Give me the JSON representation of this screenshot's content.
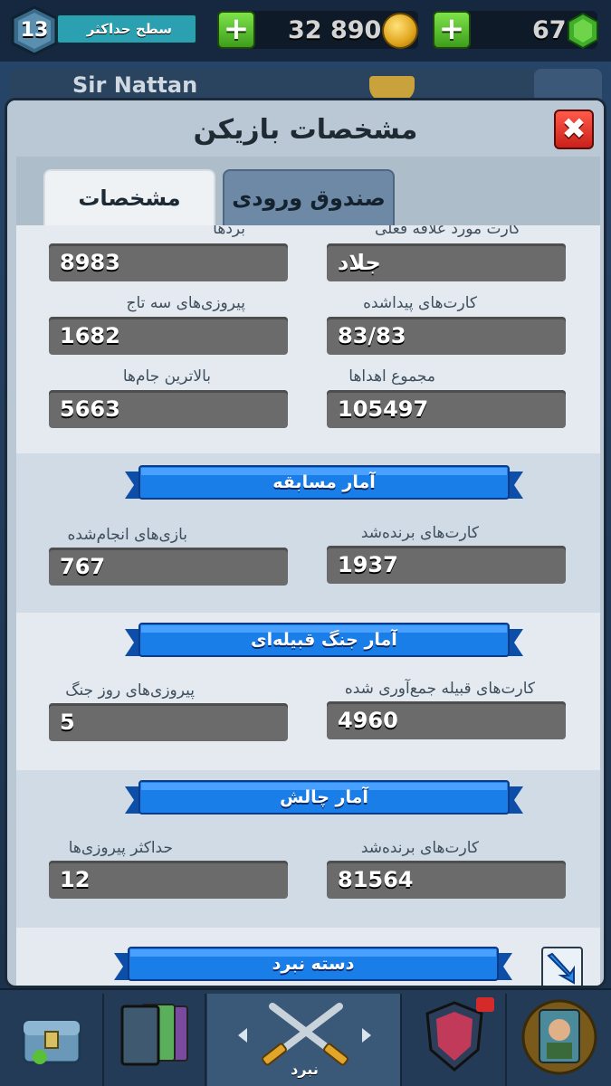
{
  "top_bar": {
    "level": "13",
    "xp_label": "سطح حداکثر",
    "gold_plus": "+",
    "gold_value": "32 890",
    "gems_plus": "+",
    "gems_value": "67"
  },
  "background": {
    "player_name": "Sir Nattan"
  },
  "modal": {
    "title": "مشخصات بازیکن",
    "close_label": "✖",
    "tabs": [
      {
        "label": "مشخصات",
        "active": true
      },
      {
        "label": "صندوق ورودی",
        "active": false
      }
    ]
  },
  "stats": {
    "wins_label": "بردها",
    "wins_value": "8983",
    "favorite_card_label": "کارت مورد علاقه فعلی",
    "favorite_card_value": "جلاد",
    "three_crown_label": "پیروزی‌های سه تاج",
    "three_crown_value": "1682",
    "cards_found_label": "کارت‌های پیداشده",
    "cards_found_value": "83/83",
    "best_trophies_label": "بالاترین جام‌ها",
    "best_trophies_value": "5663",
    "total_donations_label": "مجموع اهداها",
    "total_donations_value": "105497"
  },
  "tournament": {
    "title": "آمار مسابقه",
    "games_label": "بازی‌های انجام‌شده",
    "games_value": "767",
    "cards_won_label": "کارت‌های برنده‌شد",
    "cards_won_value": "1937"
  },
  "clan_war": {
    "title": "آمار جنگ قبیله‌ای",
    "war_wins_label": "پیروزی‌های روز جنگ",
    "war_wins_value": "5",
    "clan_cards_label": "کارت‌های قبیله جمع‌آوری شده",
    "clan_cards_value": "4960"
  },
  "challenge": {
    "title": "آمار چالش",
    "max_wins_label": "حداکثر پیروزی‌ها",
    "max_wins_value": "12",
    "cards_won_label": "کارت‌های برنده‌شد",
    "cards_won_value": "81564"
  },
  "battle_deck": {
    "title": "دسته نبرد"
  },
  "bottom_nav": {
    "center_label": "نبرد",
    "left_arrow": "◀",
    "right_arrow": "▶"
  },
  "colors": {
    "ribbon_blue": "#1a7ee8",
    "value_box": "#6b6b6b",
    "modal_bg": "#b9c8d4",
    "close_red": "#e0302a",
    "plus_green": "#5cc232"
  }
}
